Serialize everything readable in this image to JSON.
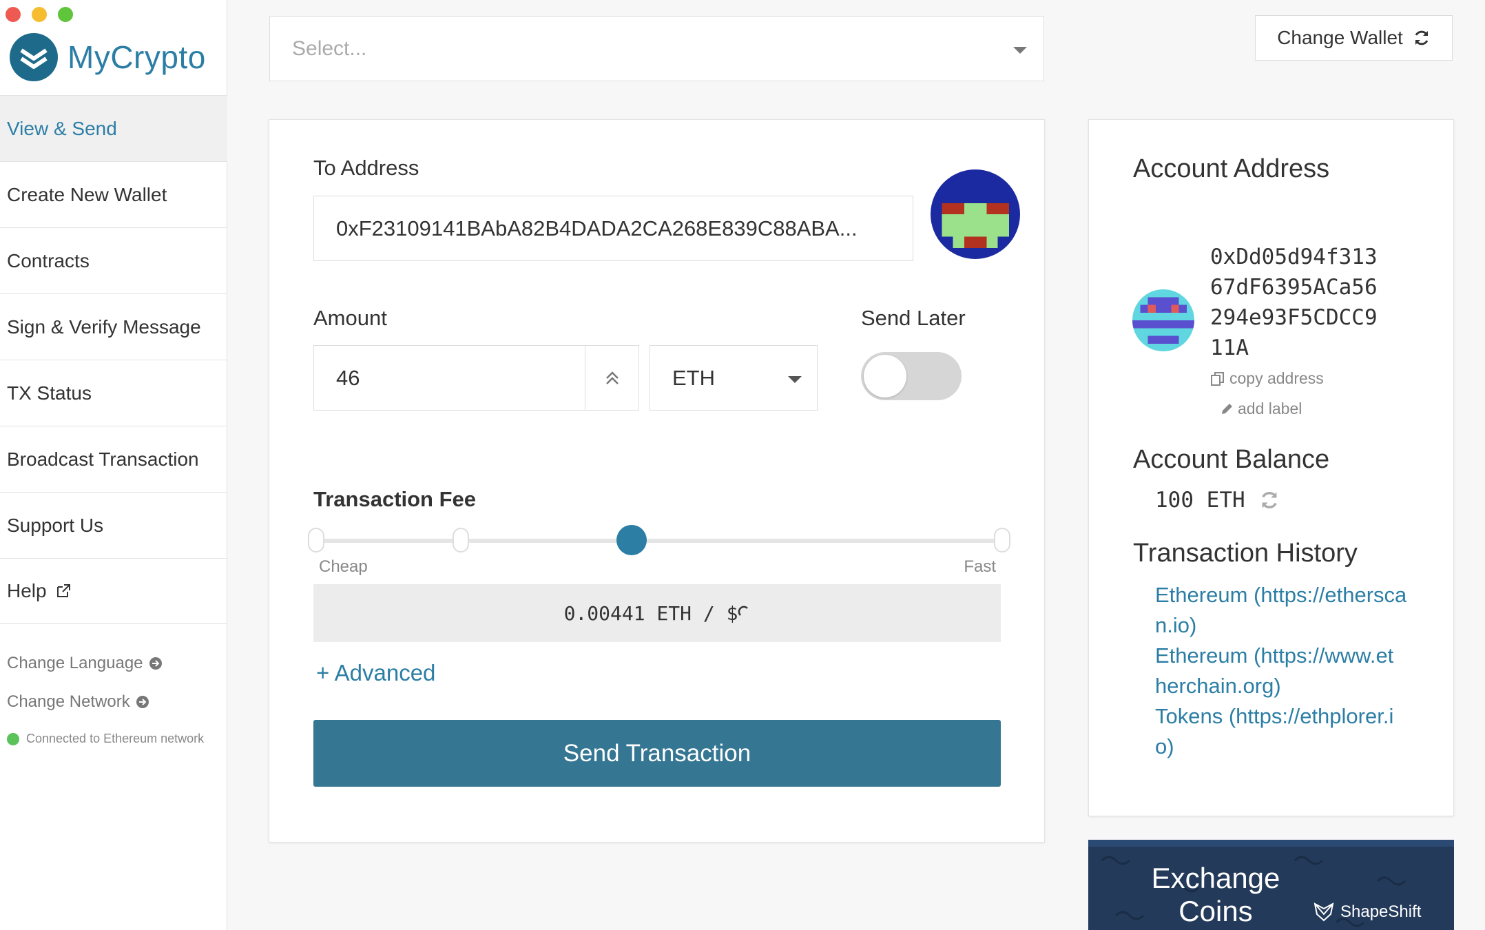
{
  "app": {
    "name": "MyCrypto"
  },
  "sidebar": {
    "items": [
      {
        "label": "View & Send"
      },
      {
        "label": "Create New Wallet"
      },
      {
        "label": "Contracts"
      },
      {
        "label": "Sign & Verify Message"
      },
      {
        "label": "TX Status"
      },
      {
        "label": "Broadcast Transaction"
      },
      {
        "label": "Support Us"
      },
      {
        "label": "Help"
      }
    ],
    "change_language": "Change Language",
    "change_network": "Change Network",
    "connection_status": "Connected to Ethereum network",
    "status_color": "#5bc35a"
  },
  "top": {
    "select_placeholder": "Select...",
    "change_wallet_label": "Change Wallet"
  },
  "send": {
    "to_address_label": "To Address",
    "to_address_value": "0xF23109141BAbA82B4DADA2CA268E839C88ABA...",
    "amount_label": "Amount",
    "amount_value": "46",
    "currency": "ETH",
    "send_later_label": "Send Later",
    "send_later_on": false,
    "fee_title": "Transaction Fee",
    "fee_slider_position": 0.46,
    "fee_cheap_label": "Cheap",
    "fee_fast_label": "Fast",
    "fee_display": "0.00441 ETH / $",
    "advanced_label": "+ Advanced",
    "send_button_label": "Send Transaction"
  },
  "account": {
    "address_title": "Account Address",
    "address_lines": [
      "0xDd05d94f313",
      "67dF6395ACa56",
      "294e93F5CDCC9",
      "11A"
    ],
    "copy_label": "copy address",
    "add_label": "add label",
    "balance_title": "Account Balance",
    "balance_value": "100 ETH",
    "history_title": "Transaction History",
    "history_links": [
      "Ethereum (https://ethersca n.io)",
      "Ethereum (https://www.et herchain.org)",
      "Tokens (https://ethplorer.i o)"
    ]
  },
  "exchange": {
    "title": "Exchange Coins",
    "brand": "ShapeShift"
  },
  "colors": {
    "accent": "#2c7ea5",
    "button": "#357693"
  }
}
